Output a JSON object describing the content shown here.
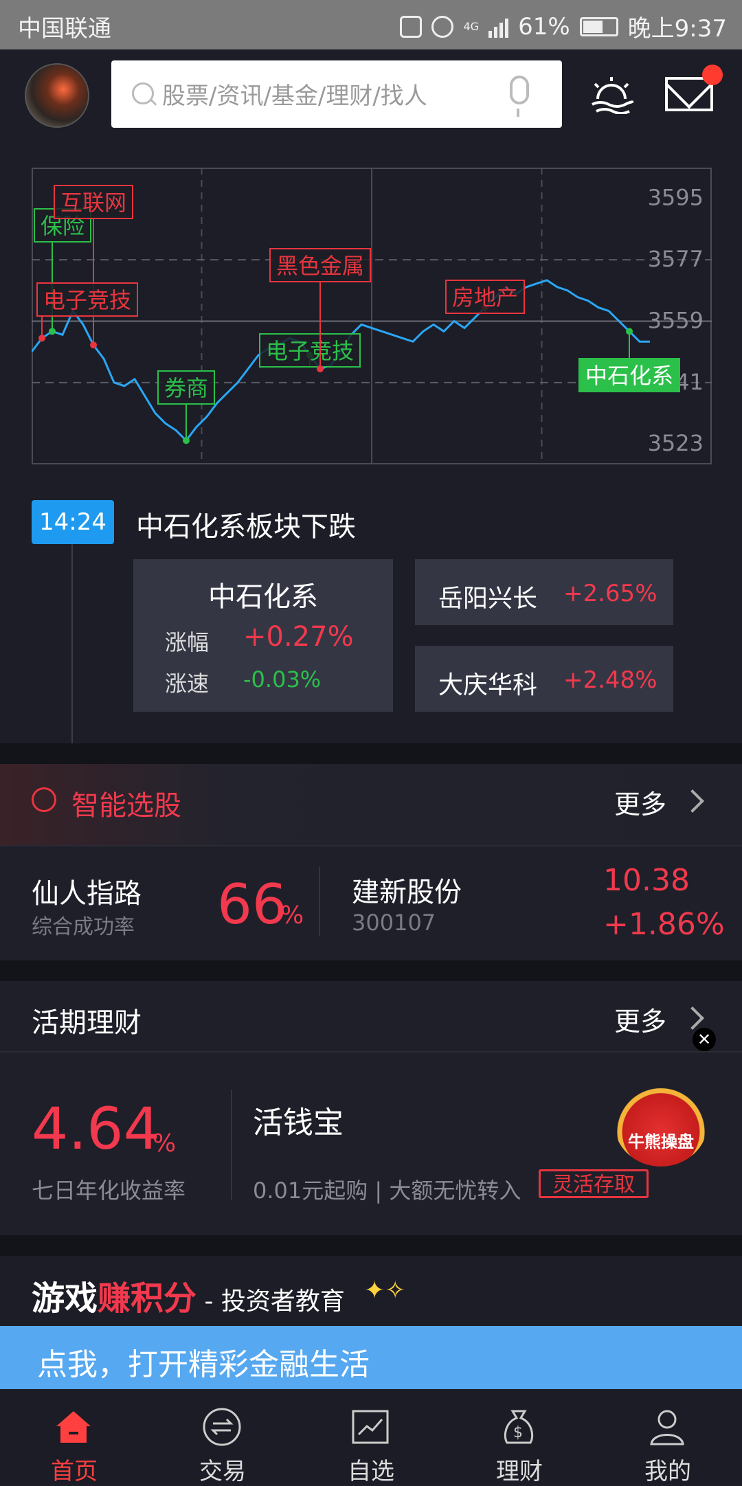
{
  "status_bar": {
    "carrier": "中国联通",
    "network": "4G",
    "battery": "61%",
    "time": "晚上9:37"
  },
  "header": {
    "search_placeholder": "股票/资讯/基金/理财/找人",
    "icons": [
      "avatar",
      "search-icon",
      "mic-icon",
      "weather-icon",
      "mail-icon"
    ]
  },
  "chart_data": {
    "type": "line",
    "y_ticks": [
      "3595",
      "3577",
      "3559",
      "3541",
      "3523"
    ],
    "ylim": [
      3517,
      3604
    ],
    "grid": true,
    "series": [
      {
        "values": [
          3550,
          3554,
          3556,
          3555,
          3562,
          3558,
          3552,
          3548,
          3541,
          3540,
          3542,
          3537,
          3532,
          3529,
          3527,
          3524,
          3528,
          3531,
          3535,
          3538,
          3541,
          3545,
          3549,
          3551,
          3552,
          3554,
          3553,
          3549,
          3545,
          3546,
          3550,
          3555,
          3558,
          3557,
          3556,
          3555,
          3554,
          3553,
          3556,
          3558,
          3556,
          3559,
          3557,
          3560,
          3563,
          3566,
          3569,
          3567,
          3569,
          3570,
          3571,
          3569,
          3568,
          3566,
          3565,
          3563,
          3562,
          3559,
          3556,
          3553,
          3553
        ]
      }
    ],
    "annotations": [
      {
        "label": "保险",
        "color": "green"
      },
      {
        "label": "互联网",
        "color": "red"
      },
      {
        "label": "电子竞技",
        "color": "red"
      },
      {
        "label": "券商",
        "color": "green"
      },
      {
        "label": "电子竞技",
        "color": "green"
      },
      {
        "label": "黑色金属",
        "color": "red"
      },
      {
        "label": "房地产",
        "color": "red"
      },
      {
        "label": "中石化系",
        "color": "green-filled"
      }
    ],
    "colors": {
      "line": "#2aa7f5",
      "red": "#e8353f",
      "green": "#2bc04a"
    }
  },
  "news": {
    "time": "14:24",
    "title": "中石化系板块下跌",
    "sector": {
      "name": "中石化系",
      "rise_label": "涨幅",
      "rise_value": "+0.27%",
      "speed_label": "涨速",
      "speed_value": "-0.03%"
    },
    "stocks": [
      {
        "name": "岳阳兴长",
        "change": "+2.65%"
      },
      {
        "name": "大庆华科",
        "change": "+2.48%"
      }
    ]
  },
  "smart_pick": {
    "title": "智能选股",
    "more": "更多",
    "strategy_name": "仙人指路",
    "strategy_sub": "综合成功率",
    "success_rate": "66",
    "percent_sign": "%",
    "stock_name": "建新股份",
    "stock_code": "300107",
    "price": "10.38",
    "change": "+1.86%"
  },
  "current_finance": {
    "title": "活期理财",
    "more": "更多",
    "rate": "4.64",
    "percent_sign": "%",
    "rate_label": "七日年化收益率",
    "product": "活钱宝",
    "desc": "0.01元起购 | 大额无忧转入",
    "tag": "灵活存取",
    "badge": "牛熊操盘",
    "close": "✕"
  },
  "game": {
    "part1": "游戏",
    "part2": "赚积分",
    "part3": " - 投资者教育"
  },
  "promo": {
    "text": "点我，打开精彩金融生活"
  },
  "tabs": [
    {
      "label": "首页"
    },
    {
      "label": "交易"
    },
    {
      "label": "自选"
    },
    {
      "label": "理财"
    },
    {
      "label": "我的"
    }
  ],
  "colors": {
    "bg": "#1c1d26",
    "red": "#f2394d",
    "green": "#2bc04a",
    "blue": "#1e9bf0"
  }
}
